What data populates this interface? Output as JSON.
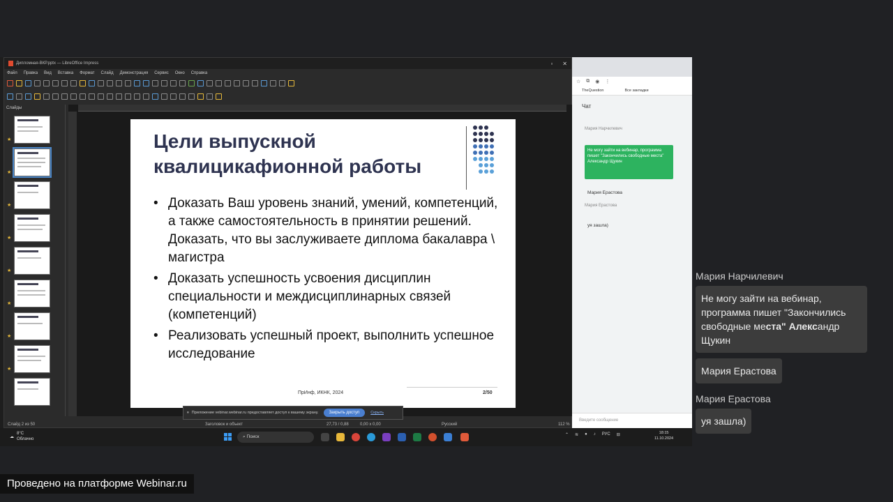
{
  "impress": {
    "title": "Дипломная-ВКР.pptx — LibreOffice Impress",
    "menu": [
      "Файл",
      "Правка",
      "Вид",
      "Вставка",
      "Формат",
      "Слайд",
      "Демонстрация",
      "Сервис",
      "Окно",
      "Справка"
    ],
    "slides_label": "Слайды",
    "slide": {
      "title": "Цели выпускной квалицикафионной работы",
      "bullets": [
        "Доказать Ваш уровень знаний, умений, компетенций, а также самостоятельность в принятии решений. Доказать, что вы заслуживаете диплома бакалавра \\ магистра",
        "Доказать успешность усвоения дисциплин специальности и междисциплинарных связей (компетенций)",
        "Реализовать успешный проект, выполнить успешное исследование"
      ],
      "footer": "ПрИнф, ИКНК, 2024",
      "number": "2/50"
    },
    "status": {
      "slide_pos": "Слайд 2 из 50",
      "layout": "Заголовок и объект",
      "coords": "27,73 / 0,88",
      "size": "0,00 x 0,00",
      "lang": "Русский",
      "zoom": "112 %"
    },
    "notice": {
      "text": "Приложение vebinar.webinar.ru предоставляет доступ к вашему экрану.",
      "button": "Закрыть доступ",
      "hide": "Скрыть"
    }
  },
  "browser": {
    "bookmark1": "TheQuestion",
    "bookmark2": "Все закладки",
    "chat_title": "Чат",
    "name1": "Мария Нарчилевич",
    "green_msg": "Не могу зайти на вебинар, программа пишет \"Закончились свободные места\" Александр Щукин",
    "name2": "Мария Ерастова",
    "name3": "Мария Ерастова",
    "msg3": "уя зашла)",
    "input_placeholder": "Введите сообщение"
  },
  "taskbar": {
    "weather_temp": "8°C",
    "weather_desc": "Облачно",
    "search": "Поиск",
    "lang": "РУС",
    "time": "18:15",
    "date": "11.10.2024"
  },
  "chat": {
    "name1": "Мария Нарчилевич",
    "msg1_plain": "Не могу зайти на вебинар, программа пишет \"Закончились свободные ме",
    "msg1_bold": "ста\" Алекс",
    "msg1_tail": "андр Щукин",
    "msg2": "Мария Ерастова",
    "name3": "Мария Ерастова",
    "msg3": "уя зашла)"
  },
  "watermark": "Проведено на платформе Webinar.ru",
  "colors": {
    "accent_green": "#2db35f",
    "dot_dark": "#2e3350",
    "dot_mid": "#3f6fb5",
    "dot_light": "#5aa0d8"
  }
}
